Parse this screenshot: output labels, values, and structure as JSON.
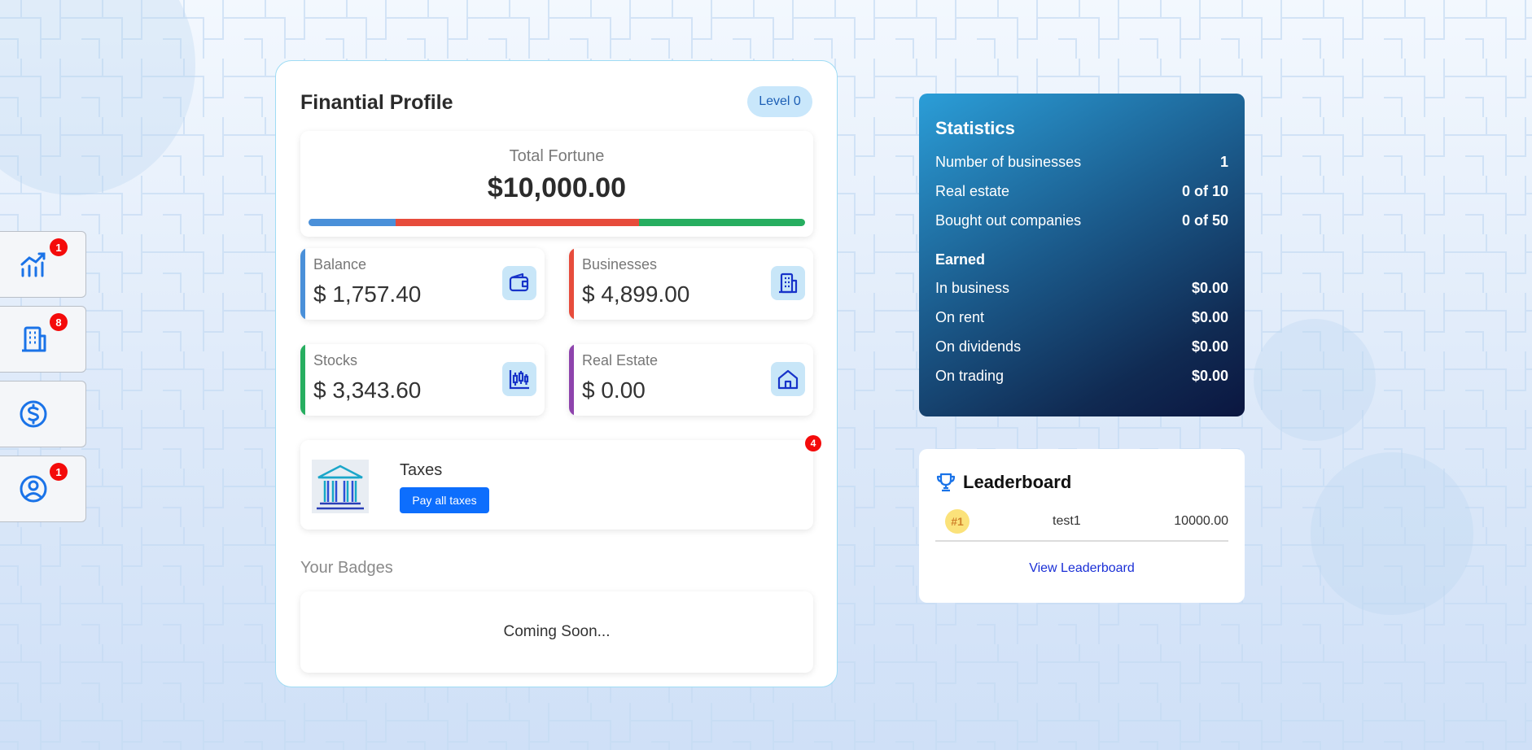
{
  "sidenav": {
    "items": [
      {
        "icon": "chart-icon",
        "badge": "1"
      },
      {
        "icon": "building-icon",
        "badge": "8"
      },
      {
        "icon": "dollar-circle-icon",
        "badge": ""
      },
      {
        "icon": "user-circle-icon",
        "badge": "1"
      }
    ]
  },
  "profile": {
    "title": "Finantial Profile",
    "level": "Level 0",
    "fortune_label": "Total Fortune",
    "fortune_value": "$10,000.00",
    "breakdown": [
      {
        "color": "#4a90d9",
        "fraction": 0.1757
      },
      {
        "color": "#e74c3c",
        "fraction": 0.4899
      },
      {
        "color": "#27ae60",
        "fraction": 0.3344
      }
    ],
    "assets": {
      "balance": {
        "label": "Balance",
        "value": "$ 1,757.40",
        "accent": "#4a90d9",
        "icon": "wallet-icon"
      },
      "businesses": {
        "label": "Businesses",
        "value": "$ 4,899.00",
        "accent": "#e74c3c",
        "icon": "building-icon"
      },
      "stocks": {
        "label": "Stocks",
        "value": "$ 3,343.60",
        "accent": "#27ae60",
        "icon": "candlestick-icon"
      },
      "real_estate": {
        "label": "Real Estate",
        "value": "$ 0.00",
        "accent": "#8e44ad",
        "icon": "house-icon"
      }
    },
    "taxes": {
      "label": "Taxes",
      "button": "Pay all taxes",
      "badge": "4"
    },
    "badges_title": "Your Badges",
    "badges_text": "Coming Soon..."
  },
  "stats": {
    "title": "Statistics",
    "rows": [
      {
        "label": "Number of businesses",
        "value": "1"
      },
      {
        "label": "Real estate",
        "value": "0 of 10"
      },
      {
        "label": "Bought out companies",
        "value": "0 of 50"
      }
    ],
    "earned_title": "Earned",
    "earned": [
      {
        "label": "In business",
        "value": "$0.00"
      },
      {
        "label": "On rent",
        "value": "$0.00"
      },
      {
        "label": "On dividends",
        "value": "$0.00"
      },
      {
        "label": "On trading",
        "value": "$0.00"
      }
    ]
  },
  "leaderboard": {
    "title": "Leaderboard",
    "rows": [
      {
        "rank": "#1",
        "name": "test1",
        "score": "10000.00"
      }
    ],
    "link": "View Leaderboard"
  }
}
